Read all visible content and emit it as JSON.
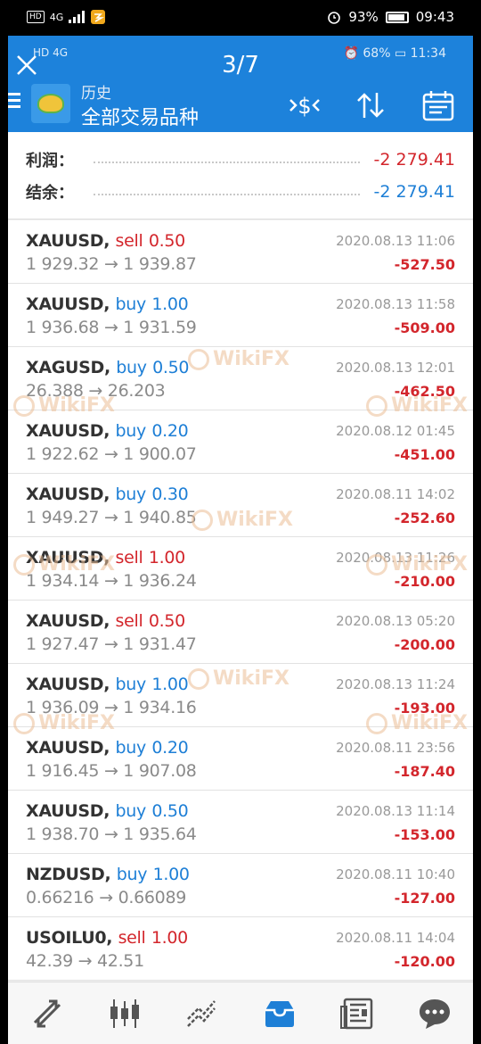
{
  "outer_status": {
    "left_chip": "HD",
    "network": "4G",
    "battery_percent": "93%",
    "time": "09:43"
  },
  "viewer": {
    "page_counter": "3/7"
  },
  "inner_status": {
    "left": "HD 4G",
    "right": "⏰ 68% ▭ 11:34"
  },
  "header": {
    "history_label": "历史",
    "symbols_label": "全部交易品种",
    "accent_color": "#1d82db"
  },
  "summary": {
    "profit_label": "利润：",
    "profit_value": "-2 279.41",
    "balance_label": "结余：",
    "balance_value": "-2 279.41"
  },
  "colors": {
    "sell": "#d3262c",
    "buy": "#1e7fd6",
    "loss": "#d3262c"
  },
  "trades": [
    {
      "symbol": "XAUUSD,",
      "side": "sell",
      "volume": "0.50",
      "prices": "1 929.32 → 1 939.87",
      "time": "2020.08.13 11:06",
      "pl": "-527.50"
    },
    {
      "symbol": "XAUUSD,",
      "side": "buy",
      "volume": "1.00",
      "prices": "1 936.68 → 1 931.59",
      "time": "2020.08.13 11:58",
      "pl": "-509.00"
    },
    {
      "symbol": "XAGUSD,",
      "side": "buy",
      "volume": "0.50",
      "prices": "26.388 → 26.203",
      "time": "2020.08.13 12:01",
      "pl": "-462.50"
    },
    {
      "symbol": "XAUUSD,",
      "side": "buy",
      "volume": "0.20",
      "prices": "1 922.62 → 1 900.07",
      "time": "2020.08.12 01:45",
      "pl": "-451.00"
    },
    {
      "symbol": "XAUUSD,",
      "side": "buy",
      "volume": "0.30",
      "prices": "1 949.27 → 1 940.85",
      "time": "2020.08.11 14:02",
      "pl": "-252.60"
    },
    {
      "symbol": "XAUUSD,",
      "side": "sell",
      "volume": "1.00",
      "prices": "1 934.14 → 1 936.24",
      "time": "2020.08.13 11:26",
      "pl": "-210.00"
    },
    {
      "symbol": "XAUUSD,",
      "side": "sell",
      "volume": "0.50",
      "prices": "1 927.47 → 1 931.47",
      "time": "2020.08.13 05:20",
      "pl": "-200.00"
    },
    {
      "symbol": "XAUUSD,",
      "side": "buy",
      "volume": "1.00",
      "prices": "1 936.09 → 1 934.16",
      "time": "2020.08.13 11:24",
      "pl": "-193.00"
    },
    {
      "symbol": "XAUUSD,",
      "side": "buy",
      "volume": "0.20",
      "prices": "1 916.45 → 1 907.08",
      "time": "2020.08.11 23:56",
      "pl": "-187.40"
    },
    {
      "symbol": "XAUUSD,",
      "side": "buy",
      "volume": "0.50",
      "prices": "1 938.70 → 1 935.64",
      "time": "2020.08.13 11:14",
      "pl": "-153.00"
    },
    {
      "symbol": "NZDUSD,",
      "side": "buy",
      "volume": "1.00",
      "prices": "0.66216 → 0.66089",
      "time": "2020.08.11 10:40",
      "pl": "-127.00"
    },
    {
      "symbol": "USOILU0,",
      "side": "sell",
      "volume": "1.00",
      "prices": "42.39 → 42.51",
      "time": "2020.08.11 14:04",
      "pl": "-120.00"
    }
  ],
  "watermark": {
    "text": "WikiFX"
  },
  "bottom_nav": {
    "items": [
      "quotes-icon",
      "chart-icon",
      "trade-icon",
      "history-icon",
      "news-icon",
      "chat-icon"
    ],
    "active": "history-icon"
  }
}
